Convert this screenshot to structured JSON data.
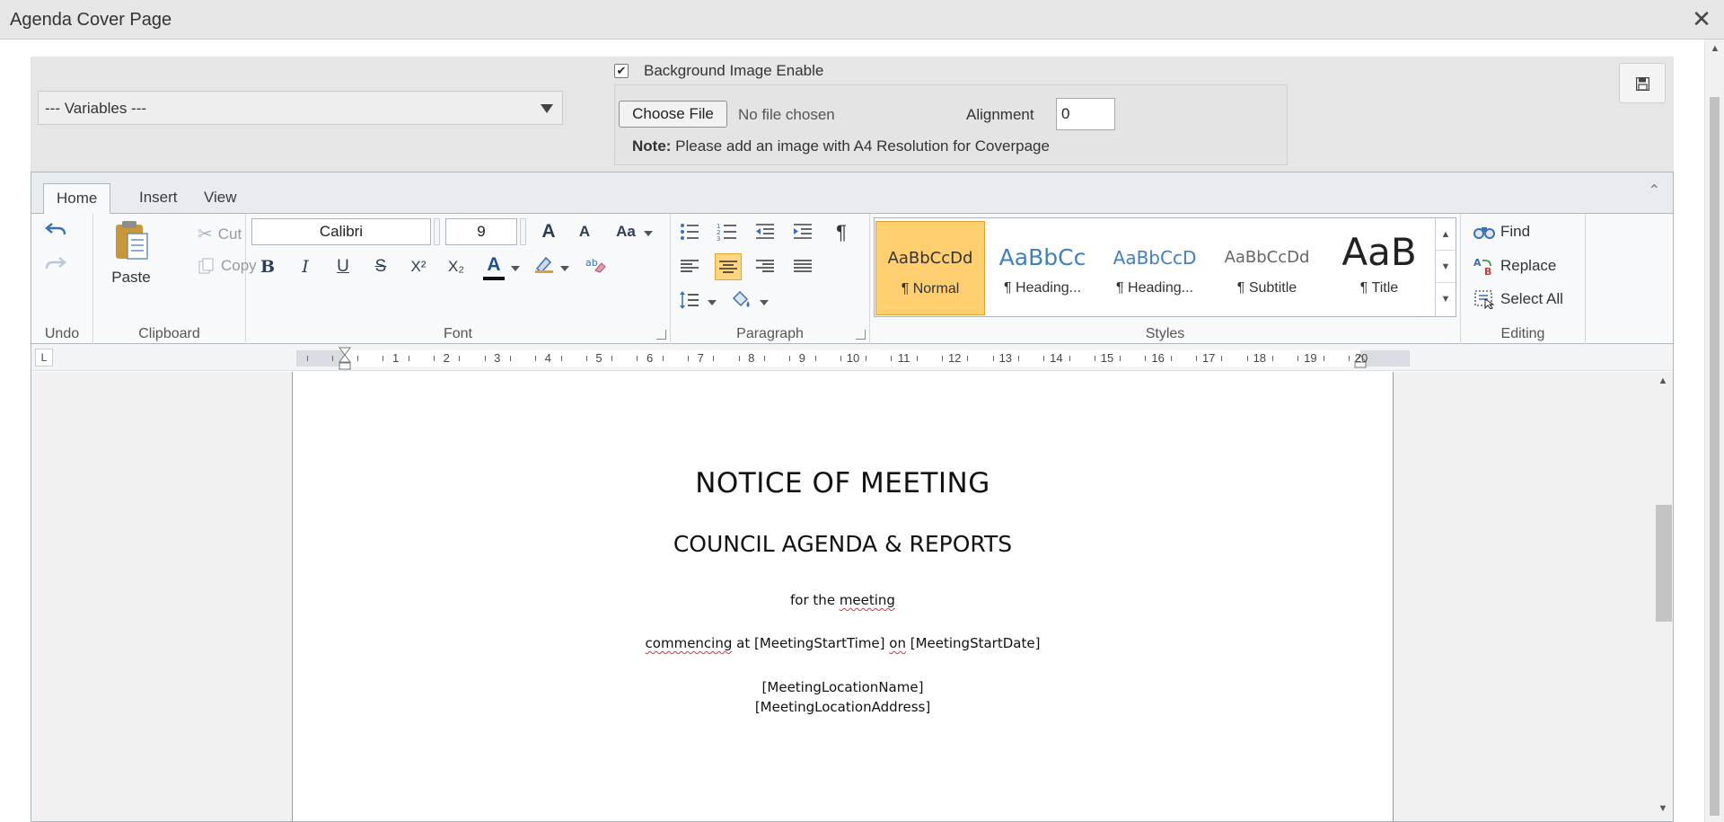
{
  "window": {
    "title": "Agenda Cover Page",
    "close_glyph": "✕"
  },
  "config": {
    "variables_select": {
      "value": "--- Variables ---"
    },
    "background_image_enable": {
      "label": "Background Image Enable",
      "checked": true
    },
    "file": {
      "choose_label": "Choose File",
      "status": "No file chosen"
    },
    "alignment": {
      "label": "Alignment",
      "value": "0"
    },
    "note": {
      "bold": "Note:",
      "text": " Please add an image with A4 Resolution for Coverpage"
    }
  },
  "ribbon": {
    "tabs": [
      {
        "label": "Home",
        "active": true
      },
      {
        "label": "Insert",
        "active": false
      },
      {
        "label": "View",
        "active": false
      }
    ],
    "groups": {
      "undo": {
        "title": "Undo"
      },
      "clipboard": {
        "title": "Clipboard",
        "paste": "Paste",
        "cut": "Cut",
        "copy": "Copy"
      },
      "font": {
        "title": "Font",
        "font_name": "Calibri",
        "font_size": "9",
        "buttons": {
          "bold": "B",
          "italic": "I",
          "underline": "U",
          "strike": "S",
          "superscript": "X²",
          "subscript": "X₂",
          "font_color": "A",
          "grow": "A",
          "shrink": "A",
          "change_case": "Aa"
        }
      },
      "paragraph": {
        "title": "Paragraph",
        "show_marks": "¶"
      },
      "styles": {
        "title": "Styles",
        "items": [
          {
            "sample": "AaBbCcDd",
            "name": "¶ Normal",
            "active": true
          },
          {
            "sample": "AaBbCc",
            "name": "¶ Heading...",
            "active": false
          },
          {
            "sample": "AaBbCcD",
            "name": "¶ Heading...",
            "active": false
          },
          {
            "sample": "AaBbCcDd",
            "name": "¶ Subtitle",
            "active": false
          },
          {
            "sample": "AaB",
            "name": "¶ Title",
            "active": false
          }
        ]
      },
      "editing": {
        "title": "Editing",
        "find": "Find",
        "replace": "Replace",
        "select_all": "Select All"
      }
    }
  },
  "ruler": {
    "numbers": [
      "1",
      "2",
      "3",
      "4",
      "5",
      "6",
      "7",
      "8",
      "9",
      "10",
      "11",
      "12",
      "13",
      "14",
      "15",
      "16",
      "17",
      "18",
      "19",
      "20"
    ]
  },
  "document": {
    "heading1": "NOTICE OF MEETING",
    "heading2": "COUNCIL AGENDA & REPORTS",
    "line_meeting": {
      "a": "for the ",
      "b": "meeting"
    },
    "line_commencing": {
      "a": "commencing",
      "b": " at [MeetingStartTime] ",
      "c": "on",
      "d": " [MeetingStartDate]"
    },
    "location_name": "[MeetingLocationName]",
    "location_address": "[MeetingLocationAddress]"
  },
  "colors": {
    "active_style": "#ffcf6f",
    "active_button": "#ffd67d",
    "icon_blue": "#3b6fb6"
  }
}
